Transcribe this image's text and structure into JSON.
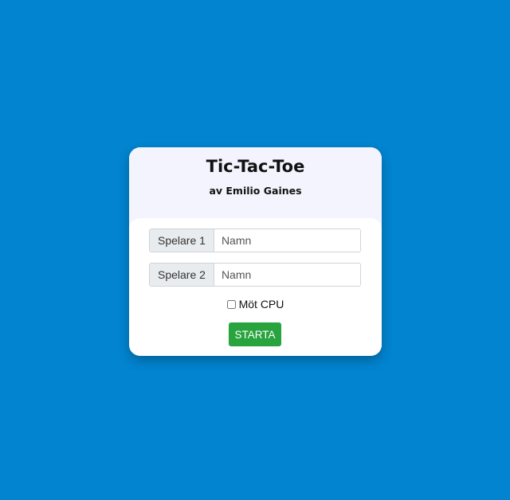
{
  "app": {
    "title": "Tic-Tac-Toe",
    "subtitle": "av Emilio Gaines"
  },
  "form": {
    "player1": {
      "label": "Spelare 1",
      "placeholder": "Namn",
      "value": ""
    },
    "player2": {
      "label": "Spelare 2",
      "placeholder": "Namn",
      "value": ""
    },
    "cpu_label": "Möt CPU",
    "cpu_checked": false,
    "start_label": "STARTA"
  },
  "colors": {
    "background": "#0284d0",
    "header_bg": "#f4f4fe",
    "start_button": "#28a33e"
  }
}
